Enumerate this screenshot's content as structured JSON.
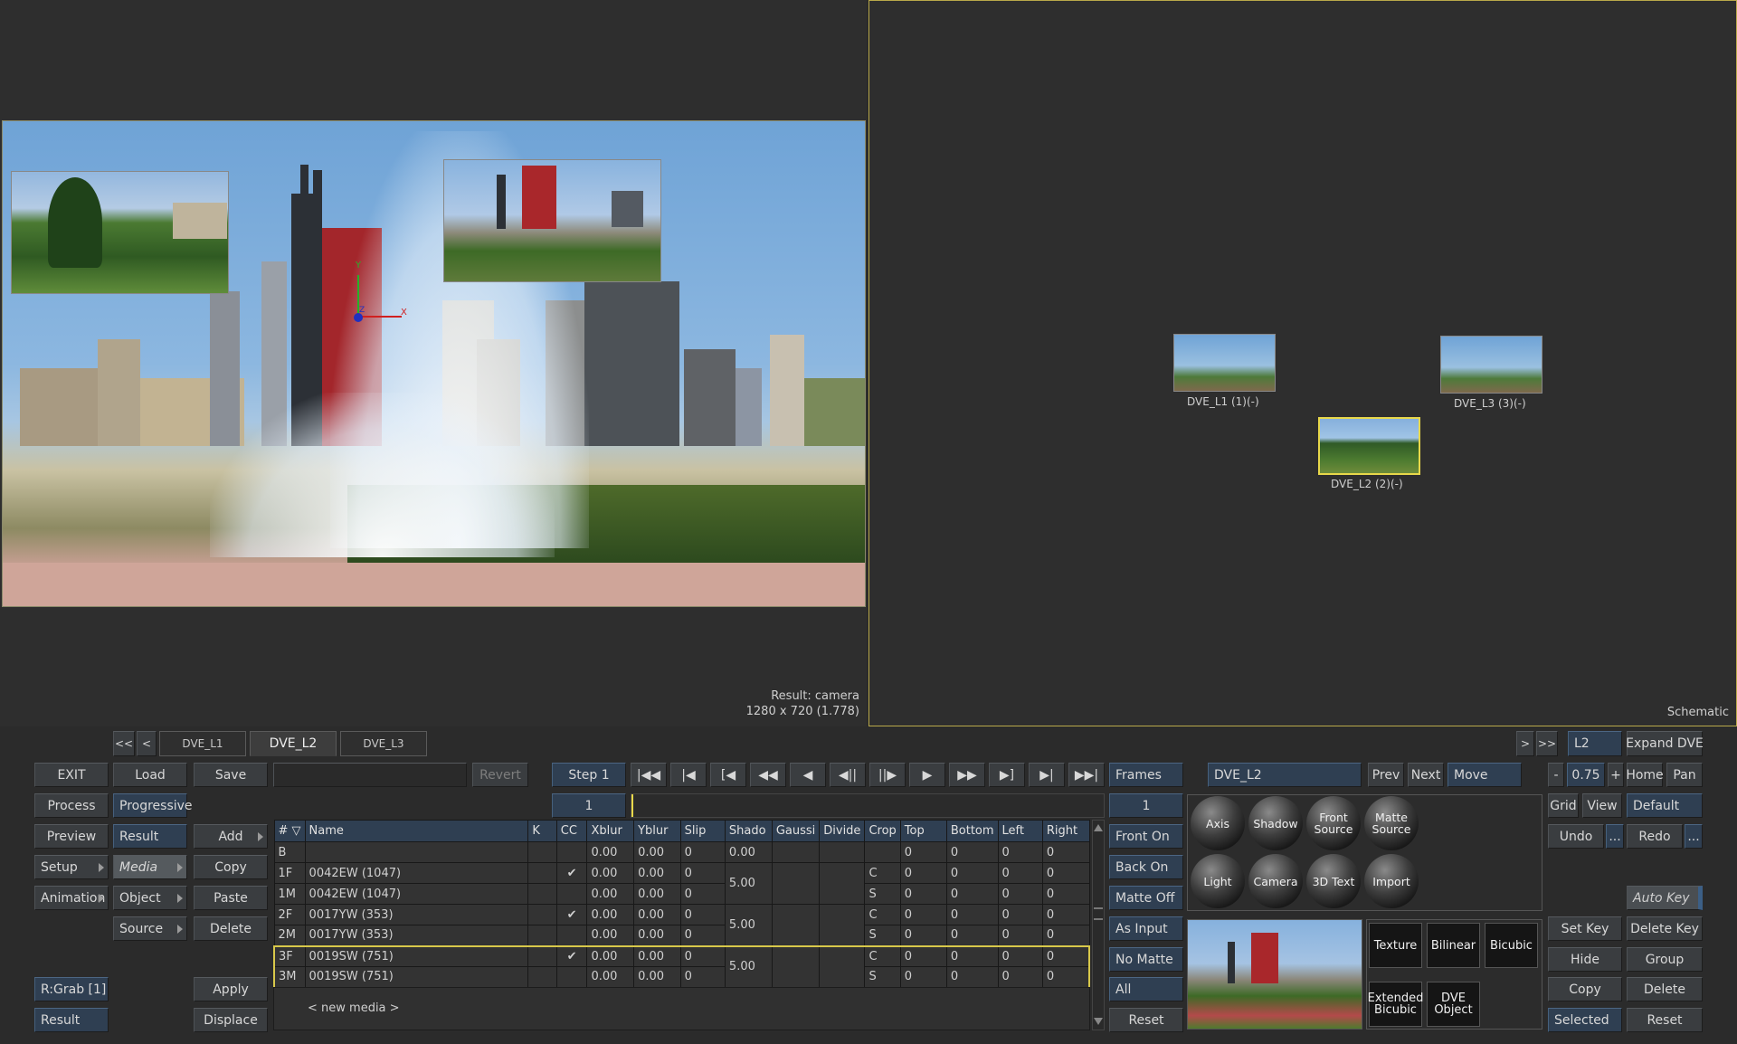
{
  "viewer": {
    "result_label": "Result: camera",
    "resolution_label": "1280 x 720 (1.778)",
    "axis": {
      "x": "X",
      "y": "Y",
      "z": "Z"
    }
  },
  "schematic": {
    "label": "Schematic",
    "nodes": [
      {
        "label": "DVE_L1 (1)(-)"
      },
      {
        "label": "DVE_L3 (3)(-)"
      },
      {
        "label": "DVE_L2 (2)(-)"
      }
    ]
  },
  "tabs": {
    "prev_all": "<<",
    "prev": "<",
    "items": [
      "DVE_L1",
      "DVE_L2",
      "DVE_L3"
    ],
    "next": ">",
    "next_all": ">>",
    "layer_field": "L2",
    "expand_dve": "Expand DVE"
  },
  "left_buttons": {
    "exit": "EXIT",
    "process": "Process",
    "preview": "Preview",
    "setup": "Setup",
    "animation": "Animation",
    "rgrab": "R:Grab [1]",
    "result": "Result"
  },
  "mid_buttons": {
    "load": "Load",
    "save": "Save",
    "progressive": "Progressive",
    "result": "Result",
    "media": "Media",
    "object": "Object",
    "source": "Source",
    "add": "Add",
    "copy": "Copy",
    "paste": "Paste",
    "delete": "Delete",
    "apply": "Apply",
    "displace": "Displace",
    "revert": "Revert"
  },
  "transport": {
    "step": "Step 1",
    "frame_field": "1",
    "frames_label": "Frames",
    "frames_value": "1"
  },
  "media_table": {
    "columns": [
      "#",
      "Name",
      "K",
      "CC",
      "Xblur",
      "Yblur",
      "Slip",
      "Shado",
      "Gaussi",
      "Divide",
      "Crop",
      "Top",
      "Bottom",
      "Left",
      "Right"
    ],
    "rows": [
      {
        "id": "B",
        "name": "",
        "cc": "",
        "xblur": "0.00",
        "yblur": "0.00",
        "slip": "0",
        "shado": "0.00",
        "crop": "",
        "top": "0",
        "bottom": "0",
        "left": "0",
        "right": "0"
      },
      {
        "id": "1F",
        "name": "0042EW (1047)",
        "cc": "✔",
        "xblur": "0.00",
        "yblur": "0.00",
        "slip": "0",
        "shado": "5.00",
        "crop": "C",
        "top": "0",
        "bottom": "0",
        "left": "0",
        "right": "0"
      },
      {
        "id": "1M",
        "name": "0042EW (1047)",
        "cc": "",
        "xblur": "0.00",
        "yblur": "0.00",
        "slip": "0",
        "shado": "",
        "crop": "S",
        "top": "0",
        "bottom": "0",
        "left": "0",
        "right": "0"
      },
      {
        "id": "2F",
        "name": "0017YW (353)",
        "cc": "✔",
        "xblur": "0.00",
        "yblur": "0.00",
        "slip": "0",
        "shado": "5.00",
        "crop": "C",
        "top": "0",
        "bottom": "0",
        "left": "0",
        "right": "0"
      },
      {
        "id": "2M",
        "name": "0017YW (353)",
        "cc": "",
        "xblur": "0.00",
        "yblur": "0.00",
        "slip": "0",
        "shado": "",
        "crop": "S",
        "top": "0",
        "bottom": "0",
        "left": "0",
        "right": "0"
      },
      {
        "id": "3F",
        "name": "0019SW (751)",
        "cc": "✔",
        "xblur": "0.00",
        "yblur": "0.00",
        "slip": "0",
        "shado": "5.00",
        "crop": "C",
        "top": "0",
        "bottom": "0",
        "left": "0",
        "right": "0"
      },
      {
        "id": "3M",
        "name": "0019SW (751)",
        "cc": "",
        "xblur": "0.00",
        "yblur": "0.00",
        "slip": "0",
        "shado": "",
        "crop": "S",
        "top": "0",
        "bottom": "0",
        "left": "0",
        "right": "0"
      }
    ],
    "new_media": "< new media >"
  },
  "matte_buttons": {
    "front_on": "Front On",
    "back_on": "Back On",
    "matte_off": "Matte Off",
    "as_input": "As Input",
    "no_matte": "No Matte",
    "all": "All",
    "reset": "Reset"
  },
  "object_panel": {
    "name_field": "DVE_L2",
    "prev": "Prev",
    "next": "Next",
    "move": "Move",
    "spheres": [
      "Axis",
      "Shadow",
      "Front Source",
      "Matte Source",
      "Light",
      "Camera",
      "3D Text",
      "Import"
    ],
    "filters": [
      "Texture",
      "Bilinear",
      "Bicubic",
      "Extended Bicubic",
      "DVE Object"
    ]
  },
  "right_panel": {
    "minus": "-",
    "zoom": "0.75",
    "plus": "+",
    "home": "Home",
    "pan": "Pan",
    "grid": "Grid",
    "view": "View",
    "default": "Default",
    "undo": "Undo",
    "dots": "...",
    "redo": "Redo",
    "auto_key": "Auto Key",
    "set_key": "Set Key",
    "delete_key": "Delete Key",
    "hide": "Hide",
    "group": "Group",
    "copy": "Copy",
    "delete": "Delete",
    "selected": "Selected",
    "reset": "Reset"
  }
}
